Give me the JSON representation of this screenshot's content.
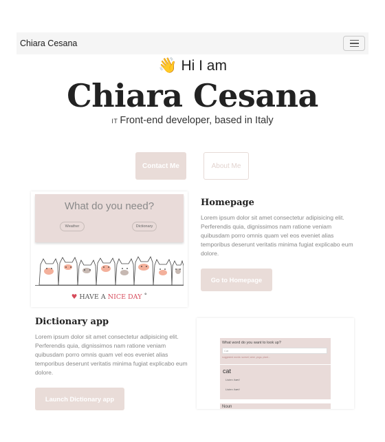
{
  "navbar": {
    "brand": "Chiara Cesana",
    "menu_icon": "hamburger-menu-icon"
  },
  "hero": {
    "greeting": "Hi I am",
    "greeting_icon": "waving-hand-icon",
    "name": "Chiara Cesana",
    "subtitle_prefix": "IT",
    "subtitle": "Front-end developer, based in Italy"
  },
  "actions": {
    "contact_label": "Contact Me",
    "about_label": "About Me"
  },
  "homepage_card": {
    "panel_title": "What do you need?",
    "pill_weather": "Weather",
    "pill_dictionary": "Dictionary",
    "banner_have": "HAVE A",
    "banner_nice_day": "NICE DAY",
    "title": "Homepage",
    "text": "Lorem ipsum dolor sit amet consectetur adipisicing elit. Perferendis quia, dignissimos nam ratione veniam quibusdam porro omnis quam vel eos eveniet alias temporibus deserunt veritatis minima fugiat explicabo eum dolore.",
    "button_label": "Go to Homepage"
  },
  "dictionary_card": {
    "title": "Dictionary app",
    "text": "Lorem ipsum dolor sit amet consectetur adipisicing elit. Perferendis quia, dignissimos nam ratione veniam quibusdam porro omnis quam vel eos eveniet alias temporibus deserunt veritatis minima fugiat explicabo eum dolore.",
    "button_label": "Launch Dictionary app",
    "preview_question": "What word do you want to look up?",
    "preview_input": "Cat",
    "preview_hint": "suggested words: sunset, wine, yoga, plant...",
    "preview_word": "cat",
    "preview_row1": "Listen   /kæt/",
    "preview_row2": "Listen   /kæt/",
    "preview_noun": "Noun"
  },
  "colors": {
    "accent_pink": "#e9dcd8",
    "link_blue": "#7b92c8",
    "nav_bg": "#f5f5f5"
  }
}
